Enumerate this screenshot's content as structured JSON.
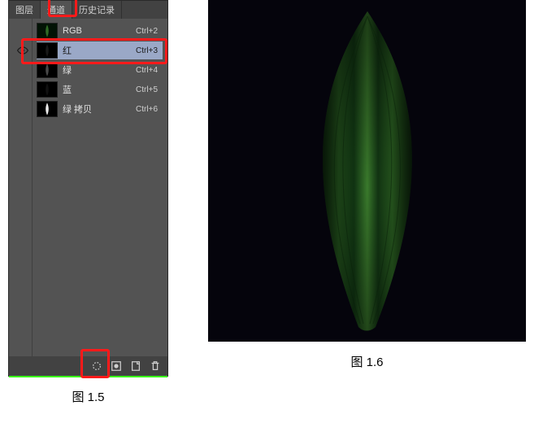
{
  "fig15_caption": "图  1.5",
  "fig16_caption": "图  1.6",
  "tabs": {
    "layers": "图层",
    "channels": "通道",
    "history": "历史记录"
  },
  "channels": [
    {
      "name": "RGB",
      "shortcut": "Ctrl+2"
    },
    {
      "name": "红",
      "shortcut": "Ctrl+3"
    },
    {
      "name": "绿",
      "shortcut": "Ctrl+4"
    },
    {
      "name": "蓝",
      "shortcut": "Ctrl+5"
    },
    {
      "name": "绿 拷贝",
      "shortcut": "Ctrl+6"
    }
  ],
  "selected_channel_index": 1
}
